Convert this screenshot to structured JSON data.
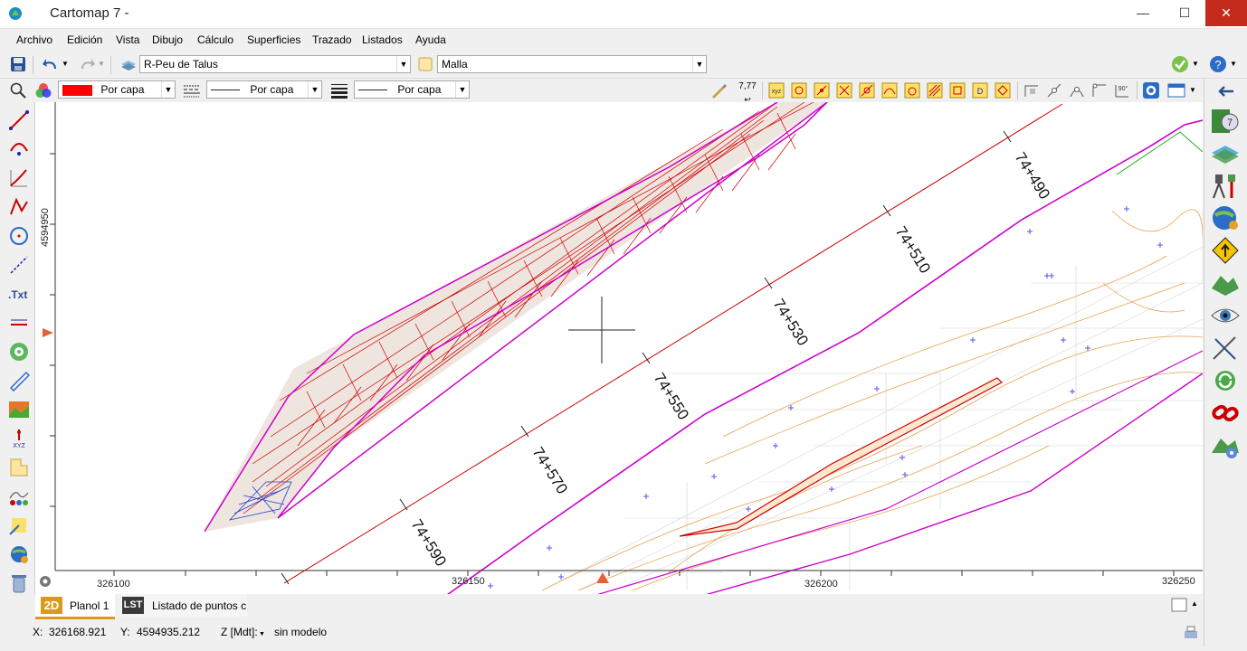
{
  "window": {
    "title": "Cartomap 7 -",
    "controls": {
      "minimize": "—",
      "maximize": "☐",
      "close": "✕"
    }
  },
  "menu": [
    "Archivo",
    "Edición",
    "Vista",
    "Dibujo",
    "Cálculo",
    "Superficies",
    "Trazado",
    "Listados",
    "Ayuda"
  ],
  "toolbar": {
    "layer_value": "R-Peu de Talus",
    "surface_value": "Malla",
    "color_label": "Por capa",
    "color_hex": "#ff0000",
    "linetype_label": "Por capa",
    "lineweight_label": "Por capa",
    "decimals_label": "7,77"
  },
  "canvas": {
    "y_axis_label": "4594950",
    "x_ticks": [
      "326100",
      "326150",
      "326200",
      "326250"
    ],
    "stations": [
      "74+490",
      "74+510",
      "74+530",
      "74+550",
      "74+570",
      "74+590"
    ]
  },
  "colors": {
    "alignment": "#cc0000",
    "boundary": "#cc00cc",
    "mesh_red": "#cc0000",
    "mesh_blue": "#1f3fcc",
    "contours": "#e8a050",
    "grid": "#c8c8c8",
    "points": "#5555ee"
  },
  "tabs": [
    {
      "badge": "2D",
      "label": "Planol 1"
    },
    {
      "badge": "LST",
      "label": "Listado de puntos c"
    }
  ],
  "status": {
    "x_label": "X:",
    "x_value": "326168.921",
    "y_label": "Y:",
    "y_value": "4594935.212",
    "z_label": "Z [Mdt]:",
    "z_value": "sin modelo"
  },
  "icons": {
    "left": [
      "zoom-icon",
      "line-icon",
      "arc-icon",
      "polyline-curve-icon",
      "polyline-icon",
      "circle-icon",
      "dimension-icon",
      "text-icon",
      "measure-icon",
      "target-icon",
      "rule-icon",
      "image-icon",
      "xyz-point-icon",
      "hatch-icon",
      "profile-icon",
      "coordinates-icon",
      "globe-icon",
      "recycle-bin-icon"
    ],
    "right": [
      "back-arrow-icon",
      "help-layers-icon",
      "surface-icon",
      "survey-instrument-icon",
      "world-icon",
      "warning-sign-icon",
      "terrain-icon",
      "eye-icon",
      "measure-tool-icon",
      "sync-icon",
      "link-icon",
      "gear-terrain-icon"
    ]
  }
}
